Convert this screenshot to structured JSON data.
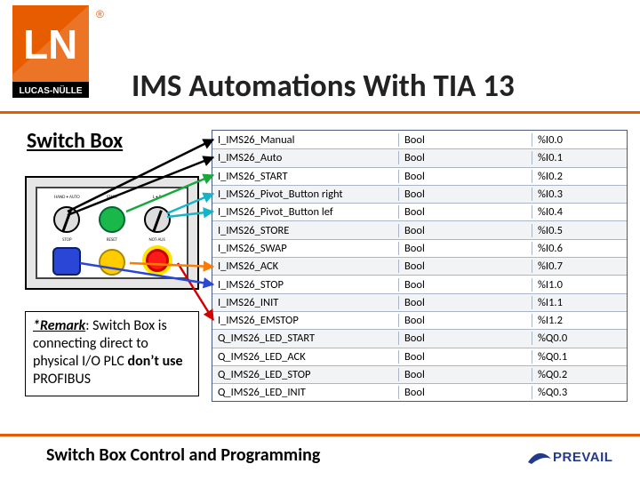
{
  "brand": {
    "logo_top": "LN",
    "logo_bottom": "LUCAS-NÜLLE",
    "reg_mark": "®"
  },
  "page": {
    "title": "IMS Automations With TIA 13",
    "section_title": "Switch Box",
    "footer_title": "Switch Box Control and Programming",
    "footer_logo": "PREVAIL"
  },
  "switchbox": {
    "labels": {
      "knob_top": "HAND • AUTO",
      "start": "START",
      "knob_right": "L • R",
      "stop": "STOP",
      "reset": "RESET",
      "notaus": "NOT-AUS"
    }
  },
  "remark": {
    "label": "*Remark",
    "sep": ": ",
    "text_1": "Switch Box is connecting direct to physical I/O PLC ",
    "dont": "don’t use",
    "text_2": " PROFIBUS"
  },
  "table": {
    "rows": [
      {
        "name": "I_IMS26_Manual",
        "type": "Bool",
        "addr": "%I0.0"
      },
      {
        "name": "I_IMS26_Auto",
        "type": "Bool",
        "addr": "%I0.1"
      },
      {
        "name": "I_IMS26_START",
        "type": "Bool",
        "addr": "%I0.2"
      },
      {
        "name": "I_IMS26_Pivot_Button right",
        "type": "Bool",
        "addr": "%I0.3"
      },
      {
        "name": "I_IMS26_Pivot_Button lef",
        "type": "Bool",
        "addr": "%I0.4"
      },
      {
        "name": "I_IMS26_STORE",
        "type": "Bool",
        "addr": "%I0.5"
      },
      {
        "name": "I_IMS26_SWAP",
        "type": "Bool",
        "addr": "%I0.6"
      },
      {
        "name": "I_IMS26_ACK",
        "type": "Bool",
        "addr": "%I0.7"
      },
      {
        "name": "I_IMS26_STOP",
        "type": "Bool",
        "addr": "%I1.0"
      },
      {
        "name": "I_IMS26_INIT",
        "type": "Bool",
        "addr": "%I1.1"
      },
      {
        "name": "I_IMS26_EMSTOP",
        "type": "Bool",
        "addr": "%I1.2"
      },
      {
        "name": "Q_IMS26_LED_START",
        "type": "Bool",
        "addr": "%Q0.0"
      },
      {
        "name": "Q_IMS26_LED_ACK",
        "type": "Bool",
        "addr": "%Q0.1"
      },
      {
        "name": "Q_IMS26_LED_STOP",
        "type": "Bool",
        "addr": "%Q0.2"
      },
      {
        "name": "Q_IMS26_LED_INIT",
        "type": "Bool",
        "addr": "%Q0.3"
      }
    ]
  },
  "colors": {
    "arrow_green": "#17a83b",
    "arrow_cyan": "#16b4c8",
    "arrow_red": "#d40000",
    "arrow_blue": "#2946d6",
    "arrow_orange": "#ff7a00",
    "arrow_black": "#000000"
  }
}
